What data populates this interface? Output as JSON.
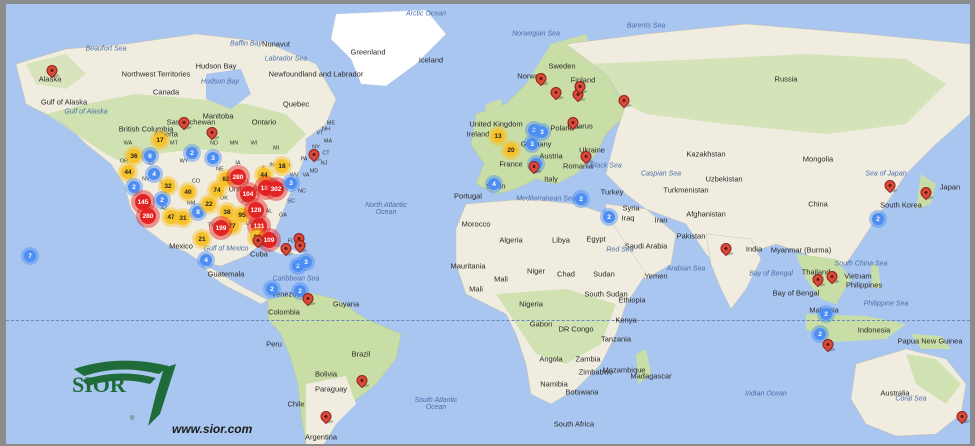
{
  "brand": {
    "logo_text": "SIOR",
    "logo_reg": "®",
    "url": "www.sior.com",
    "color": "#1f6b3a"
  },
  "colors": {
    "ocean": "#a9c6f0",
    "land": "#f2eedf",
    "green_land": "#b9d59a",
    "ice": "#ffffff",
    "blue_cluster": "#4d8ef5",
    "yellow_cluster": "#f7c12a",
    "red_cluster": "#e32424",
    "pin": "#d94a3a"
  },
  "labels": {
    "countries": [
      "Greenland",
      "Iceland",
      "Canada",
      "Russia",
      "Sweden",
      "Finland",
      "Norway",
      "United Kingdom",
      "Ireland",
      "Germany",
      "Poland",
      "Belarus",
      "Ukraine",
      "France",
      "Austria",
      "Romania",
      "Italy",
      "Spain",
      "Portugal",
      "Turkey",
      "Kazakhstan",
      "Mongolia",
      "China",
      "Uzbekistan",
      "Turkmenistan",
      "Afghanistan",
      "Iran",
      "Iraq",
      "Syria",
      "Pakistan",
      "India",
      "Saudi Arabia",
      "Egypt",
      "Libya",
      "Algeria",
      "Morocco",
      "Mali",
      "Mauritania",
      "Niger",
      "Chad",
      "Sudan",
      "Yemen",
      "Ethiopia",
      "South Sudan",
      "Nigeria",
      "Kenya",
      "DR Congo",
      "Tanzania",
      "Angola",
      "Zambia",
      "Namibia",
      "Botswana",
      "Zimbabwe",
      "Mozambique",
      "Madagascar",
      "South Africa",
      "Gabon",
      "Myanmar (Burma)",
      "Thailand",
      "Vietnam",
      "Philippines",
      "Malaysia",
      "Indonesia",
      "Papua New Guinea",
      "South Korea",
      "Japan",
      "Australia",
      "Mexico",
      "Cuba",
      "Guatemala",
      "Venezuela",
      "Colombia",
      "Guyana",
      "Peru",
      "Brazil",
      "Bolivia",
      "Chile",
      "Argentina",
      "Paraguay",
      "Nunavut",
      "Alaska",
      "Gulf of Alaska",
      "Hudson Bay",
      "Ontario",
      "Quebec",
      "Manitoba",
      "Saskatchewan",
      "Alberta",
      "British Columbia",
      "Northwest Territories",
      "Newfoundland and Labrador",
      "United States",
      "Mali",
      "Bay of Bengal"
    ],
    "states": [
      "WA",
      "OR",
      "CA",
      "NV",
      "ID",
      "MT",
      "WY",
      "UT",
      "CO",
      "NM",
      "AZ",
      "TX",
      "ND",
      "SD",
      "NE",
      "KS",
      "OK",
      "MN",
      "IA",
      "MO",
      "AR",
      "LA",
      "WI",
      "IL",
      "MI",
      "IN",
      "OH",
      "KY",
      "TN",
      "MS",
      "AL",
      "GA",
      "FL",
      "SC",
      "NC",
      "VA",
      "WV",
      "PA",
      "NY",
      "VT",
      "ME",
      "NJ",
      "MD",
      "NH",
      "MA",
      "CT"
    ],
    "oceans": [
      "North Atlantic Ocean",
      "South Atlantic Ocean",
      "Indian Ocean",
      "Arabian Sea",
      "Bay of Bengal",
      "South China Sea",
      "Sea of Japan",
      "Philippine Sea",
      "Coral Sea",
      "Caribbean Sea",
      "Gulf of Mexico",
      "Norwegian Sea",
      "Barents Sea",
      "Labrador Sea",
      "Beaufort Sea",
      "Mediterranean Sea",
      "Black Sea",
      "Caspian Sea",
      "Red Sea",
      "Arctic Ocean",
      "Hudson Bay",
      "Baffin Bay",
      "Gulf of Alaska"
    ]
  },
  "clusters": [
    {
      "v": "17",
      "t": "yellow"
    },
    {
      "v": "36",
      "t": "yellow"
    },
    {
      "v": "6",
      "t": "blue"
    },
    {
      "v": "2",
      "t": "blue"
    },
    {
      "v": "3",
      "t": "blue"
    },
    {
      "v": "44",
      "t": "yellow"
    },
    {
      "v": "4",
      "t": "blue"
    },
    {
      "v": "40",
      "t": "yellow"
    },
    {
      "v": "32",
      "t": "yellow"
    },
    {
      "v": "2",
      "t": "blue"
    },
    {
      "v": "2",
      "t": "blue"
    },
    {
      "v": "145",
      "t": "red"
    },
    {
      "v": "280",
      "t": "red"
    },
    {
      "v": "47",
      "t": "yellow"
    },
    {
      "v": "31",
      "t": "yellow"
    },
    {
      "v": "8",
      "t": "blue"
    },
    {
      "v": "22",
      "t": "yellow"
    },
    {
      "v": "74",
      "t": "yellow"
    },
    {
      "v": "62",
      "t": "yellow"
    },
    {
      "v": "280",
      "t": "red"
    },
    {
      "v": "104",
      "t": "red"
    },
    {
      "v": "38",
      "t": "yellow"
    },
    {
      "v": "95",
      "t": "yellow"
    },
    {
      "v": "77",
      "t": "yellow"
    },
    {
      "v": "199",
      "t": "red"
    },
    {
      "v": "21",
      "t": "yellow"
    },
    {
      "v": "44",
      "t": "yellow"
    },
    {
      "v": "18",
      "t": "yellow"
    },
    {
      "v": "185",
      "t": "red"
    },
    {
      "v": "302",
      "t": "red"
    },
    {
      "v": "3",
      "t": "blue"
    },
    {
      "v": "128",
      "t": "red"
    },
    {
      "v": "131",
      "t": "red"
    },
    {
      "v": "34",
      "t": "yellow"
    },
    {
      "v": "109",
      "t": "red"
    },
    {
      "v": "2",
      "t": "blue"
    },
    {
      "v": "3",
      "t": "blue"
    },
    {
      "v": "4",
      "t": "blue"
    },
    {
      "v": "2",
      "t": "blue"
    },
    {
      "v": "2",
      "t": "blue"
    },
    {
      "v": "7",
      "t": "blue"
    },
    {
      "v": "13",
      "t": "yellow"
    },
    {
      "v": "20",
      "t": "yellow"
    },
    {
      "v": "2",
      "t": "blue"
    },
    {
      "v": "3",
      "t": "blue"
    },
    {
      "v": "2",
      "t": "blue"
    },
    {
      "v": "4",
      "t": "blue"
    },
    {
      "v": "2",
      "t": "blue"
    },
    {
      "v": "2",
      "t": "blue"
    },
    {
      "v": "2",
      "t": "blue"
    },
    {
      "v": "2",
      "t": "blue"
    },
    {
      "v": "2",
      "t": "blue"
    },
    {
      "v": "3",
      "t": "blue"
    }
  ],
  "pin_count": 26
}
